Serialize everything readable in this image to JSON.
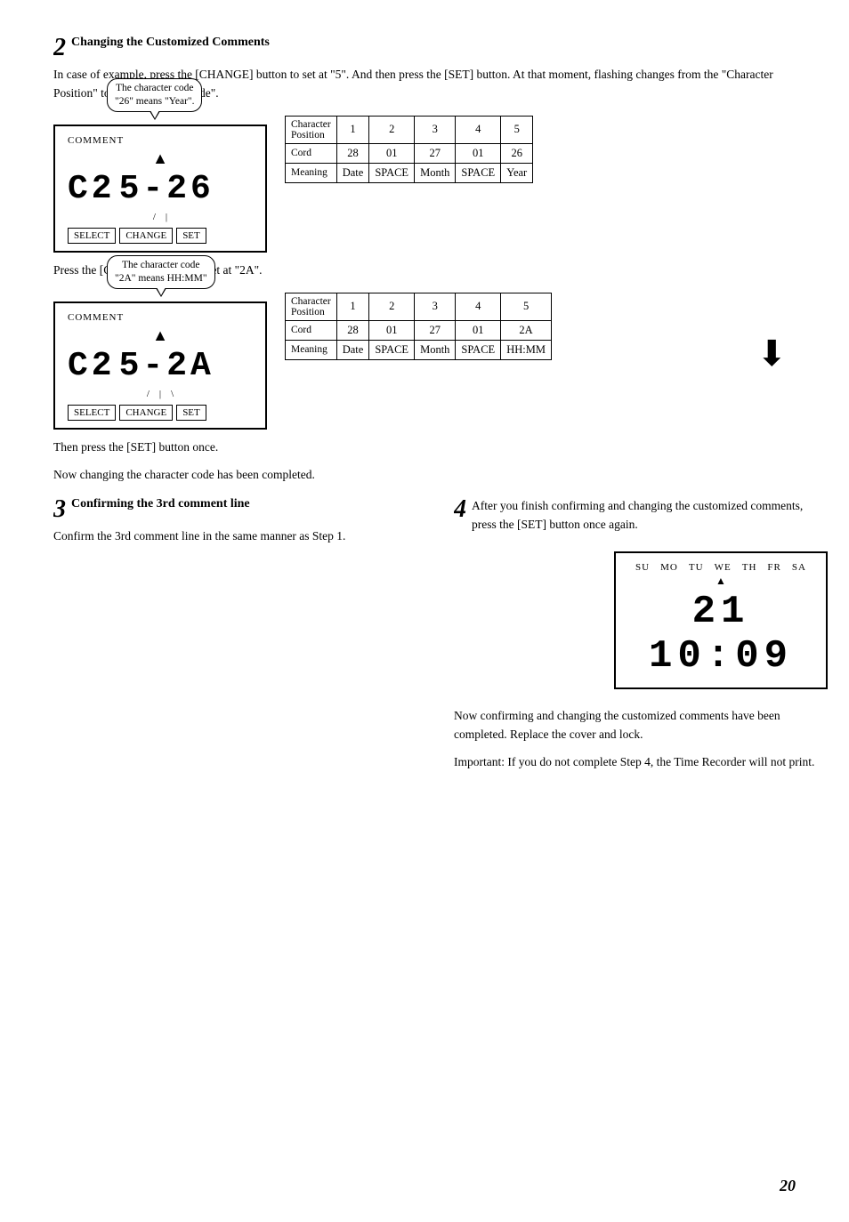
{
  "page": {
    "number": "20"
  },
  "step2": {
    "number": "2",
    "title": "Changing the Customized Comments",
    "body1": "In  case  of  example,  press  the [CHANGE] button to set at \"5\". And then press the [SET] button. At that moment, flashing changes from the \"Character  Position\"  to  the \"Character Code\".",
    "callout1": "The character code\n\"26\" means \"Year\".",
    "display1_label": "COMMENT",
    "display1_left": "C2",
    "display1_right": "5-26",
    "buttons": [
      "SELECT",
      "CHANGE",
      "SET"
    ],
    "body2": "Press the [CHANGE] button to set at \"2A\".",
    "callout2": "The character code\n\"2A\" means HH:MM\"",
    "display2_label": "COMMENT",
    "display2_left": "C2",
    "display2_right": "5-2A",
    "body3": "Then press the [SET] button once.",
    "body4": "Now changing the character code has been completed."
  },
  "step3": {
    "number": "3",
    "title": "Confirming the 3rd comment line",
    "body": "Confirm the 3rd comment line in the same manner as Step 1."
  },
  "step4": {
    "number": "4",
    "body1": "After  you  finish  confirming  and changing  the  customized  comments, press the [SET] button once again.",
    "days": [
      "SU",
      "MO",
      "TU",
      "WE",
      "TH",
      "FR",
      "SA"
    ],
    "clock_display": "21 10:09",
    "body2": "Now  confirming  and  changing  the customized  comments  have  been completed.  Replace  the  cover  and lock.",
    "body3": "Important: If you do not complete Step 4, the Time Recorder will  not print."
  },
  "table1": {
    "headers": [
      "Character\nPosition",
      "1",
      "2",
      "3",
      "4",
      "5"
    ],
    "rows": [
      [
        "Cord",
        "28",
        "01",
        "27",
        "01",
        "26"
      ],
      [
        "Meaning",
        "Date",
        "SPACE",
        "Month",
        "SPACE",
        "Year"
      ]
    ]
  },
  "table2": {
    "headers": [
      "Character\nPosition",
      "1",
      "2",
      "3",
      "4",
      "5"
    ],
    "rows": [
      [
        "Cord",
        "28",
        "01",
        "27",
        "01",
        "2A"
      ],
      [
        "Meaning",
        "Date",
        "SPACE",
        "Month",
        "SPACE",
        "HH:MM"
      ]
    ]
  }
}
